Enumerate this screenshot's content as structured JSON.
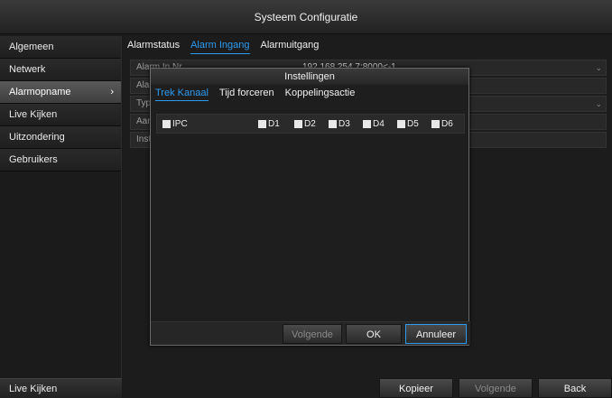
{
  "window": {
    "title": "Systeem Configuratie"
  },
  "sidebar": {
    "items": [
      {
        "label": "Algemeen"
      },
      {
        "label": "Netwerk"
      },
      {
        "label": "Alarmopname",
        "chevron": "›"
      },
      {
        "label": "Live Kijken"
      },
      {
        "label": "Uitzondering"
      },
      {
        "label": "Gebruikers"
      }
    ],
    "bottom_label": "Live Kijken"
  },
  "main": {
    "tabs": [
      {
        "label": "Alarmstatus"
      },
      {
        "label": "Alarm Ingang"
      },
      {
        "label": "Alarmuitgang"
      }
    ],
    "form": {
      "row1_label": "Alarm In Nr.",
      "row1_value": "192.168.254.7:8000<-1",
      "row2_label": "Ala",
      "row3_label": "Typ",
      "row4_label": "Aan",
      "row5_label": "Inst"
    },
    "buttons": {
      "copy": "Kopieer",
      "next": "Volgende",
      "back": "Back"
    }
  },
  "modal": {
    "title": "Instellingen",
    "tabs": [
      {
        "label": "Trek Kanaal"
      },
      {
        "label": "Tijd forceren"
      },
      {
        "label": "Koppelingsactie"
      }
    ],
    "channels": {
      "ipc": "IPC",
      "d1": "D1",
      "d2": "D2",
      "d3": "D3",
      "d4": "D4",
      "d5": "D5",
      "d6": "D6"
    },
    "buttons": {
      "next": "Volgende",
      "ok": "OK",
      "cancel": "Annuleer"
    }
  },
  "colors": {
    "accent": "#2d9bf0",
    "background": "#1a1a1a"
  }
}
